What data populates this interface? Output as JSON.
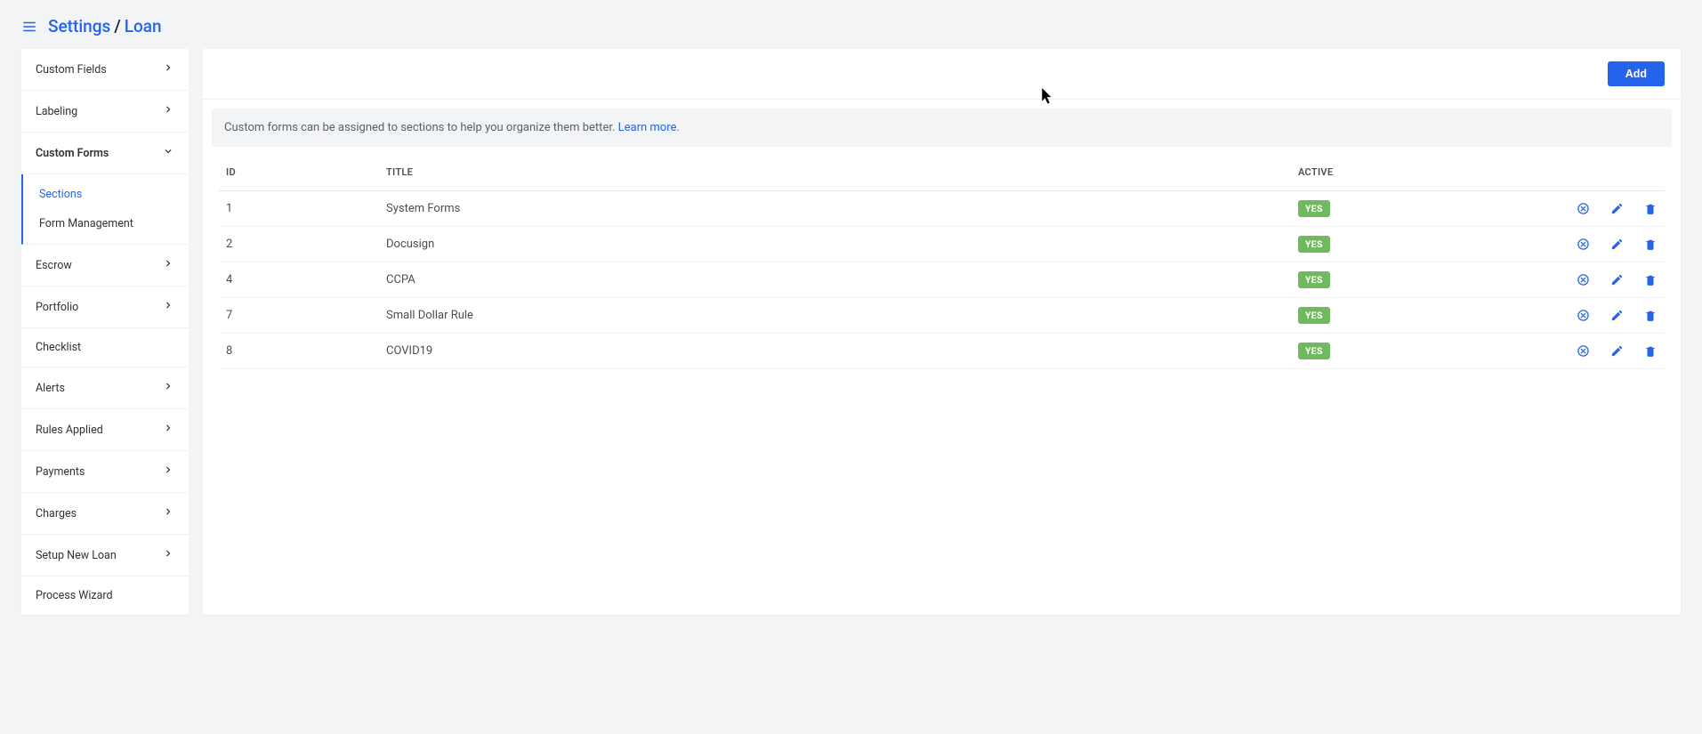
{
  "breadcrumb": {
    "root": "Settings",
    "sep": "/",
    "leaf": "Loan"
  },
  "sidebar": [
    {
      "label": "Custom Fields",
      "chevron": "right"
    },
    {
      "label": "Labeling",
      "chevron": "right"
    },
    {
      "label": "Custom Forms",
      "chevron": "down",
      "expanded": true,
      "children": [
        {
          "label": "Sections",
          "active": true
        },
        {
          "label": "Form Management"
        }
      ]
    },
    {
      "label": "Escrow",
      "chevron": "right"
    },
    {
      "label": "Portfolio",
      "chevron": "right"
    },
    {
      "label": "Checklist"
    },
    {
      "label": "Alerts",
      "chevron": "right"
    },
    {
      "label": "Rules Applied",
      "chevron": "right"
    },
    {
      "label": "Payments",
      "chevron": "right"
    },
    {
      "label": "Charges",
      "chevron": "right"
    },
    {
      "label": "Setup New Loan",
      "chevron": "right"
    },
    {
      "label": "Process Wizard"
    }
  ],
  "main": {
    "add_label": "Add",
    "banner_text": "Custom forms can be assigned to sections to help you organize them better. ",
    "banner_link": "Learn more",
    "banner_dot": "."
  },
  "table": {
    "headers": {
      "id": "ID",
      "title": "TITLE",
      "active": "ACTIVE"
    },
    "active_badge": "YES",
    "rows": [
      {
        "id": "1",
        "title": "System Forms"
      },
      {
        "id": "2",
        "title": "Docusign"
      },
      {
        "id": "4",
        "title": "CCPA"
      },
      {
        "id": "7",
        "title": "Small Dollar Rule"
      },
      {
        "id": "8",
        "title": "COVID19"
      }
    ]
  }
}
